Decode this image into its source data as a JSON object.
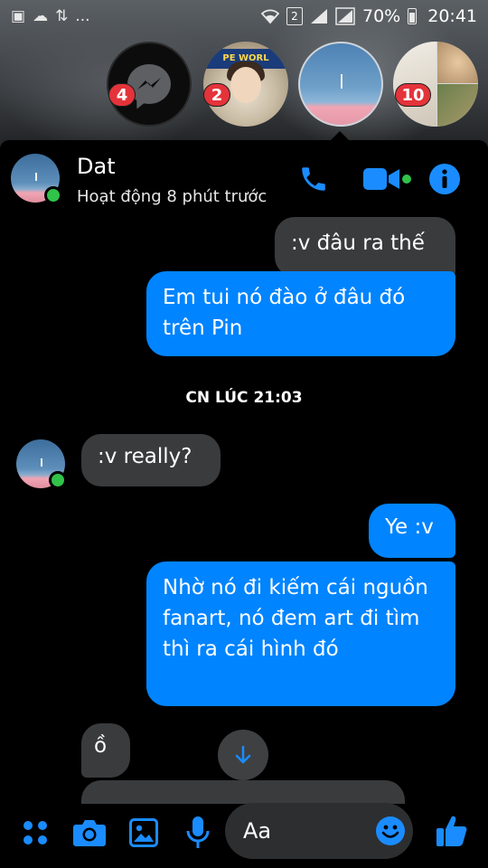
{
  "status_bar": {
    "battery": "70%",
    "time": "20:41",
    "sim_slot": "2",
    "overflow": "..."
  },
  "chat_heads": [
    {
      "name": "messenger",
      "badge": "4"
    },
    {
      "name": "contact-photo",
      "badge": "2",
      "band_text": "PE WORL"
    },
    {
      "name": "dat",
      "badge": ""
    },
    {
      "name": "group-collage",
      "badge": "10"
    }
  ],
  "header": {
    "name": "Dat",
    "status": "Hoạt động 8 phút trước"
  },
  "messages": [
    {
      "direction": "out",
      "text": ":v đâu ra thế",
      "style": "in"
    },
    {
      "direction": "out",
      "text": "Em tui nó đào ở đâu đó trên Pin"
    },
    {
      "direction": "in",
      "text": ":v really?"
    },
    {
      "direction": "out",
      "text": "Ye :v"
    },
    {
      "direction": "out",
      "text": "Nhờ nó đi kiếm cái nguồn fanart, nó đem art đi tìm thì ra cái hình đó"
    },
    {
      "direction": "in",
      "text": "ồ"
    }
  ],
  "timestamp": "CN LÚC 21:03",
  "composer": {
    "placeholder": "Aa"
  },
  "colors": {
    "accent": "#1a8cff",
    "outgoing_bubble": "#0084ff",
    "incoming_bubble": "#3a3b3d",
    "online": "#31c24a",
    "badge": "#e4333a"
  }
}
